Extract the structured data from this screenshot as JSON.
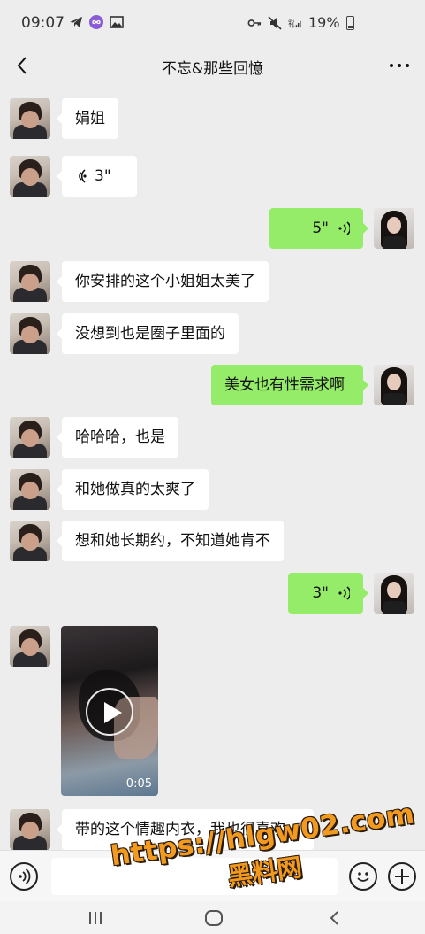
{
  "status_bar": {
    "time": "09:07",
    "battery": "19%",
    "icons_left": [
      "telegram-icon",
      "infinity-badge-icon",
      "gallery-icon"
    ],
    "icons_right": [
      "key-icon",
      "mute-icon",
      "4g-signal-icon",
      "battery-icon"
    ]
  },
  "header": {
    "title": "不忘&那些回憶",
    "back_icon": "chevron-left-icon",
    "more_icon": "more-dots-icon"
  },
  "messages": [
    {
      "side": "left",
      "type": "text",
      "text": "娟姐"
    },
    {
      "side": "left",
      "type": "voice",
      "duration": "3\""
    },
    {
      "side": "right",
      "type": "voice",
      "duration": "5\""
    },
    {
      "side": "left",
      "type": "text",
      "text": "你安排的这个小姐姐太美了"
    },
    {
      "side": "left",
      "type": "text",
      "text": "没想到也是圈子里面的"
    },
    {
      "side": "right",
      "type": "text",
      "text": "美女也有性需求啊"
    },
    {
      "side": "left",
      "type": "text",
      "text": "哈哈哈，也是"
    },
    {
      "side": "left",
      "type": "text",
      "text": "和她做真的太爽了"
    },
    {
      "side": "left",
      "type": "text",
      "text": "想和她长期约，不知道她肯不"
    },
    {
      "side": "right",
      "type": "voice",
      "duration": "3\""
    },
    {
      "side": "left",
      "type": "video",
      "duration": "0:05"
    },
    {
      "side": "left",
      "type": "text",
      "text": "带的这个情趣内衣，我也很喜欢，"
    }
  ],
  "input_bar": {
    "voice_icon": "voice-input-icon",
    "emoji_icon": "emoji-icon",
    "plus_icon": "plus-icon"
  },
  "watermark": {
    "url": "https://hlgw02.com",
    "text": "黑料网"
  },
  "colors": {
    "background": "#ededed",
    "bubble_out": "#95ec69",
    "bubble_in": "#ffffff",
    "watermark": "#f29a1f"
  }
}
